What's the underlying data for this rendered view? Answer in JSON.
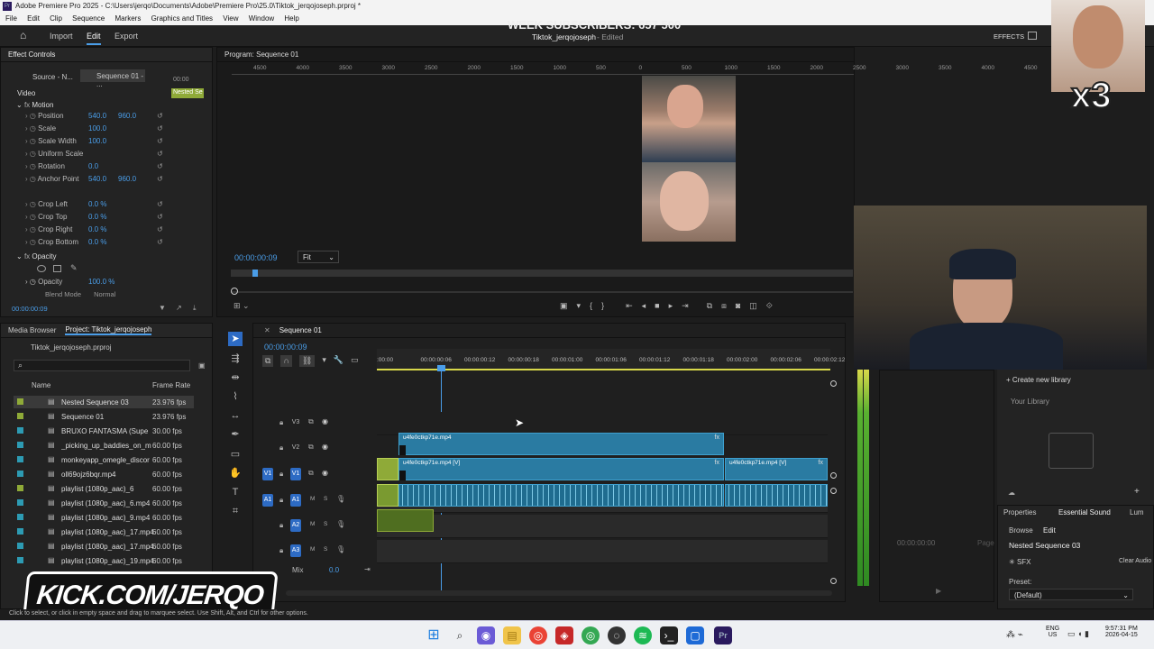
{
  "app": {
    "title": "Adobe Premiere Pro 2025 - C:\\Users\\jerqo\\Documents\\Adobe\\Premiere Pro\\25.0\\Tiktok_jerqojoseph.prproj *"
  },
  "menu": [
    "File",
    "Edit",
    "Clip",
    "Sequence",
    "Markers",
    "Graphics and Titles",
    "View",
    "Window",
    "Help"
  ],
  "workspace": {
    "home": "⌂",
    "import": "Import",
    "edit": "Edit",
    "export": "Export",
    "project_name": "Tiktok_jerqojoseph",
    "status": "- Edited",
    "overlay_banner": "WEEK SUBSCRIBERS: 657 500",
    "effects": "EFFECTS"
  },
  "effect_controls": {
    "tab": "Effect Controls",
    "source_tab": "Source - N...",
    "seq_tab": "Sequence 01 - ...",
    "time_start": "00:00",
    "clip_label": "Nested Se",
    "section_video": "Video",
    "motion": "Motion",
    "rows": [
      {
        "label": "Position",
        "v1": "540.0",
        "v2": "960.0"
      },
      {
        "label": "Scale",
        "v1": "100.0",
        "v2": ""
      },
      {
        "label": "Scale Width",
        "v1": "100.0",
        "v2": ""
      },
      {
        "label": "Uniform Scale",
        "v1": "",
        "v2": ""
      },
      {
        "label": "Rotation",
        "v1": "0.0",
        "v2": ""
      },
      {
        "label": "Anchor Point",
        "v1": "540.0",
        "v2": "960.0"
      },
      {
        "label": "Crop Left",
        "v1": "0.0 %",
        "v2": ""
      },
      {
        "label": "Crop Top",
        "v1": "0.0 %",
        "v2": ""
      },
      {
        "label": "Crop Right",
        "v1": "0.0 %",
        "v2": ""
      },
      {
        "label": "Crop Bottom",
        "v1": "0.0 %",
        "v2": ""
      }
    ],
    "opacity_section": "Opacity",
    "opacity_label": "Opacity",
    "opacity_value": "100.0 %",
    "blend_label": "Blend Mode",
    "blend_value": "Normal",
    "timecode": "00:00:00:09"
  },
  "program": {
    "tab": "Program: Sequence 01",
    "timecode": "00:00:00:09",
    "fit": "Fit",
    "ruler": [
      "4500",
      "4000",
      "3500",
      "3000",
      "2500",
      "2000",
      "1500",
      "1000",
      "500",
      "0",
      "500",
      "1000",
      "1500",
      "2000",
      "2500",
      "3000",
      "3500",
      "4000",
      "4500"
    ]
  },
  "project": {
    "tab_media": "Media Browser",
    "tab_project": "Project: Tiktok_jerqojoseph",
    "file": "Tiktok_jerqojoseph.prproj",
    "col_name": "Name",
    "col_rate": "Frame Rate",
    "items": [
      {
        "name": "Nested Sequence 03",
        "rate": "23.976 fps",
        "color": "#8faa38"
      },
      {
        "name": "Sequence 01",
        "rate": "23.976 fps",
        "color": "#8faa38"
      },
      {
        "name": "BRUXO FANTASMA (Supe",
        "rate": "30.00 fps",
        "color": "#2d9bb3"
      },
      {
        "name": "_picking_up_baddies_on_m",
        "rate": "60.00 fps",
        "color": "#2d9bb3"
      },
      {
        "name": "monkeyapp_omegle_discor",
        "rate": "60.00 fps",
        "color": "#2d9bb3"
      },
      {
        "name": "oll69ojz6bqr.mp4",
        "rate": "60.00 fps",
        "color": "#2d9bb3"
      },
      {
        "name": "playlist (1080p_aac)_6",
        "rate": "60.00 fps",
        "color": "#8faa38"
      },
      {
        "name": "playlist (1080p_aac)_6.mp4",
        "rate": "60.00 fps",
        "color": "#2d9bb3"
      },
      {
        "name": "playlist (1080p_aac)_9.mp4",
        "rate": "60.00 fps",
        "color": "#2d9bb3"
      },
      {
        "name": "playlist (1080p_aac)_17.mp4",
        "rate": "60.00 fps",
        "color": "#2d9bb3"
      },
      {
        "name": "playlist (1080p_aac)_17.mp4",
        "rate": "60.00 fps",
        "color": "#2d9bb3"
      },
      {
        "name": "playlist (1080p_aac)_19.mp4",
        "rate": "60.00 fps",
        "color": "#2d9bb3"
      }
    ]
  },
  "timeline": {
    "tab": "Sequence 01",
    "timecode": "00:00:00:09",
    "ruler": [
      ":00:00",
      "00:00:00:06",
      "00:00:00:12",
      "00:00:00:18",
      "00:00:01:00",
      "00:00:01:06",
      "00:00:01:12",
      "00:00:01:18",
      "00:00:02:00",
      "00:00:02:06",
      "00:00:02:12"
    ],
    "tracks": [
      "V3",
      "V2",
      "V1",
      "A1",
      "A2",
      "A3"
    ],
    "mix_label": "Mix",
    "mix_value": "0.0",
    "clip_v2": "u4fe0ctkp71e.mp4",
    "clip_v1": "u4fe0ctkp71e.mp4 [V]",
    "clip_v1b": "u4fe0ctkp71e.mp4 [V]"
  },
  "right": {
    "create_library": "+ Create new library",
    "your_library": "Your Library",
    "properties": "Properties",
    "essential_sound": "Essential Sound",
    "lum": "Lum",
    "browse": "Browse",
    "edit": "Edit",
    "seq": "Nested Sequence 03",
    "sfx": "SFX",
    "clear_audio": "Clear Audio",
    "preset_label": "Preset:",
    "preset_value": "(Default)",
    "time": "00:00:00:00",
    "page": "Page"
  },
  "overlay": {
    "kick": "KICK.COM/JERQO",
    "x3": "x3"
  },
  "status": {
    "hint": "Click to select, or click in empty space and drag to marquee select. Use Shift, Alt, and Ctrl for other options."
  },
  "taskbar": {
    "lang1": "ENG",
    "lang2": "US",
    "time": "9:57:31 PM",
    "date": "2026-04-15"
  }
}
